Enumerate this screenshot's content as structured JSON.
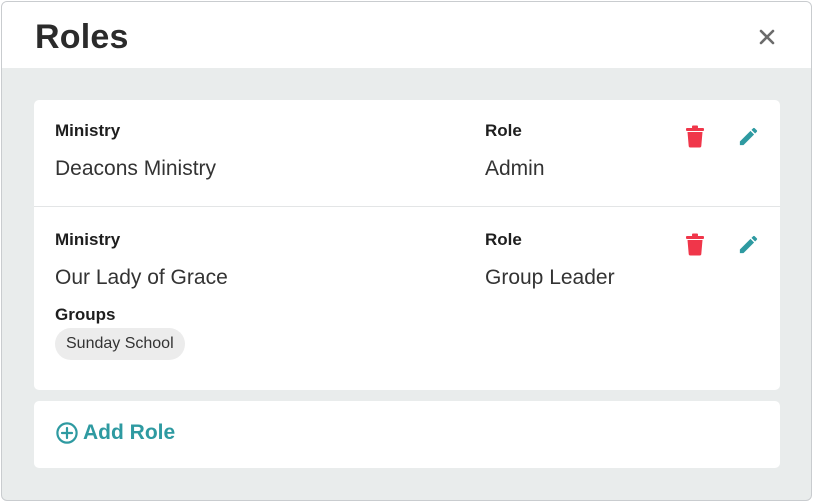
{
  "modal": {
    "title": "Roles",
    "close_icon": "close-icon"
  },
  "roles": [
    {
      "ministry_label": "Ministry",
      "ministry": "Deacons Ministry",
      "role_label": "Role",
      "role": "Admin",
      "groups_label": "",
      "groups": []
    },
    {
      "ministry_label": "Ministry",
      "ministry": "Our Lady of Grace",
      "role_label": "Role",
      "role": "Group Leader",
      "groups_label": "Groups",
      "groups": [
        "Sunday School"
      ]
    }
  ],
  "actions": {
    "delete_icon": "trash-icon",
    "edit_icon": "pencil-icon",
    "add_role_label": "Add Role",
    "add_role_icon": "plus-circle-icon"
  },
  "colors": {
    "delete": "#f0364a",
    "accent": "#2e9aa1",
    "backdrop": "#e9ecec",
    "title": "#2b2b2b"
  }
}
